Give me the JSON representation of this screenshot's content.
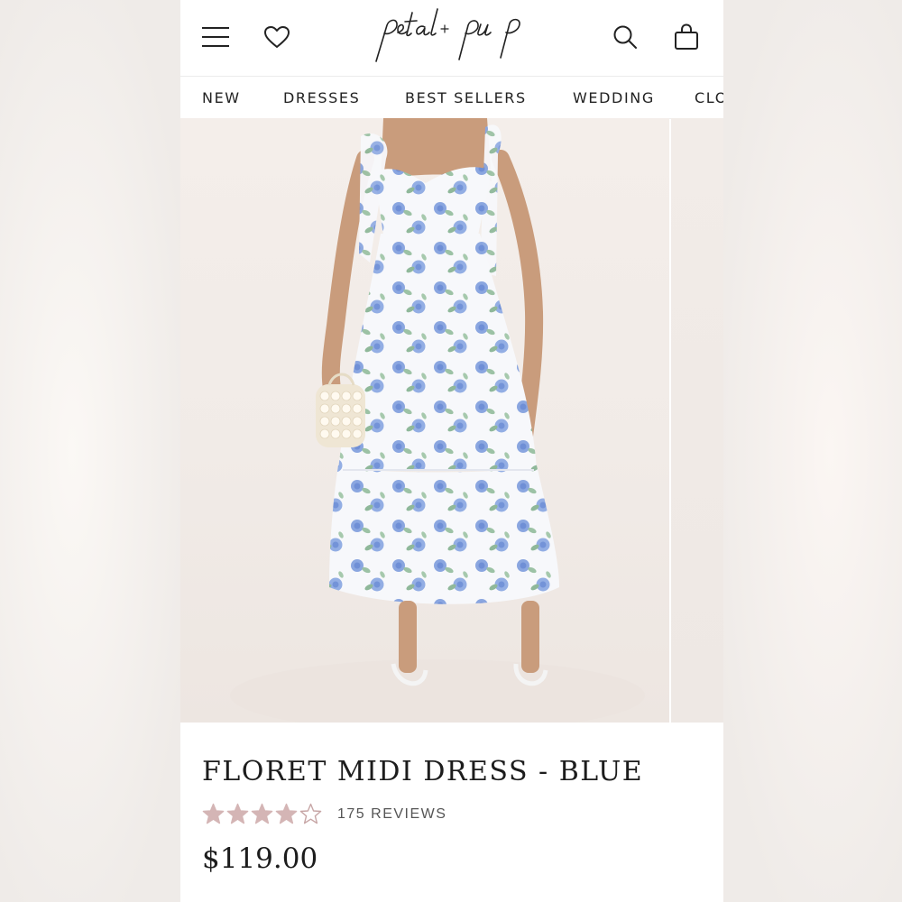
{
  "brand": {
    "logo_text": "petal+pup"
  },
  "header": {
    "icons": [
      "menu-icon",
      "heart-icon",
      "search-icon",
      "bag-icon"
    ]
  },
  "nav": {
    "items": [
      {
        "label": "NEW"
      },
      {
        "label": "DRESSES"
      },
      {
        "label": "BEST SELLERS"
      },
      {
        "label": "WEDDING"
      },
      {
        "label": "CLO"
      }
    ]
  },
  "gallery": {
    "slide_count": 10,
    "active_index": 2
  },
  "product": {
    "title": "FLORET MIDI DRESS - BLUE",
    "rating": 4,
    "rating_max": 5,
    "reviews_label": "175 REVIEWS",
    "price": "$119.00"
  },
  "colors": {
    "star_filled": "#d4b5b5",
    "star_empty": "#c7a6a6",
    "text": "#1c1c1c",
    "dress_blue": "#7f9ddc",
    "leaf_green": "#8fb89a"
  }
}
